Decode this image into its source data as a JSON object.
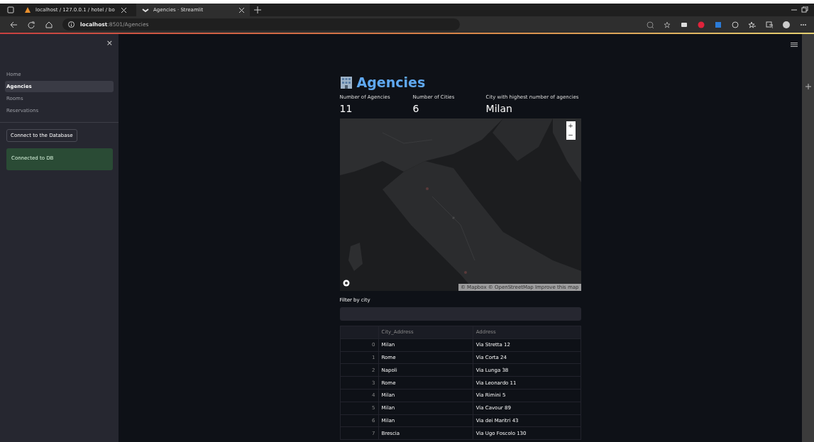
{
  "browser": {
    "tabs": [
      {
        "label": "localhost / 127.0.0.1 / hotel / bo",
        "selected": false
      },
      {
        "label": "Agencies · Streamlit",
        "selected": true
      }
    ],
    "address": "**localhost**:8501/Agencies"
  },
  "sidebar": {
    "close": "×",
    "items": [
      {
        "label": "Home",
        "selected": false
      },
      {
        "label": "Agencies",
        "selected": true
      },
      {
        "label": "Rooms",
        "selected": false
      },
      {
        "label": "Reservations",
        "selected": false
      }
    ],
    "button": "Connect to the Database",
    "alert": {
      "kind": "success",
      "text": "Connected to DB"
    }
  },
  "main": {
    "title": "Agencies",
    "metrics": [
      {
        "label": "Number of Agencies",
        "value": "11"
      },
      {
        "label": "Number of Cities",
        "value": "6"
      },
      {
        "label": "City with highest number of agencies",
        "value": "Milan"
      }
    ],
    "map": {
      "kind": "picture",
      "zoom_in": "+",
      "zoom_out": "−",
      "attribution": "© Mapbox © OpenStreetMap Improve this map"
    },
    "filter": {
      "label": "Filter by city"
    },
    "table": {
      "columns": [
        "City_Address",
        "Address"
      ],
      "rows": [
        {
          "index": "0",
          "city": "Milan",
          "address": "Via Stretta 12"
        },
        {
          "index": "1",
          "city": "Rome",
          "address": "Via Corta 24"
        },
        {
          "index": "2",
          "city": "Napoli",
          "address": "Via Lunga 38"
        },
        {
          "index": "3",
          "city": "Rome",
          "address": "Via Leonardo 11"
        },
        {
          "index": "4",
          "city": "Milan",
          "address": "Via Rimini 5"
        },
        {
          "index": "5",
          "city": "Milan",
          "address": "Via Cavour 89"
        },
        {
          "index": "6",
          "city": "Milan",
          "address": "Via dei Maritri 43"
        },
        {
          "index": "7",
          "city": "Brescia",
          "address": "Via Ugo Foscolo 130"
        }
      ]
    }
  }
}
